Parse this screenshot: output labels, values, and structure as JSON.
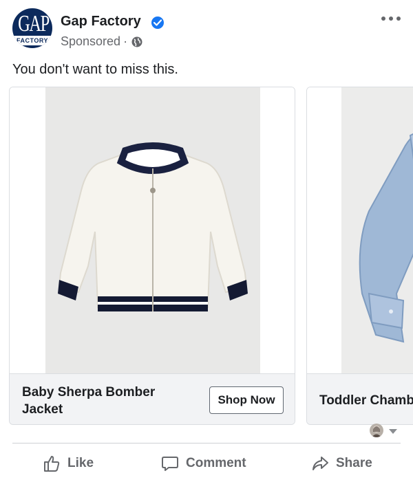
{
  "post": {
    "logo_top": "GAP",
    "logo_bottom": "FACTORY",
    "page_name": "Gap Factory",
    "sponsored": "Sponsored",
    "separator": "·",
    "caption": "You don't want to miss this."
  },
  "carousel": {
    "cards": [
      {
        "title": "Baby Sherpa Bomber Jacket",
        "cta": "Shop Now",
        "image": "white-sherpa-bomber-jacket"
      },
      {
        "title": "Toddler Chambray",
        "image": "blue-chambray-shirt"
      }
    ]
  },
  "actions": {
    "like": "Like",
    "comment": "Comment",
    "share": "Share"
  },
  "icons": {
    "verified": "verified-badge-icon",
    "globe": "globe-icon",
    "more": "more-options-icon",
    "like": "thumbs-up-icon",
    "comment": "comment-bubble-icon",
    "share": "share-arrow-icon",
    "caret": "caret-down-icon"
  },
  "colors": {
    "brand_navy": "#0c2a5c",
    "verified_blue": "#1877f2",
    "muted_text": "#65676b"
  }
}
